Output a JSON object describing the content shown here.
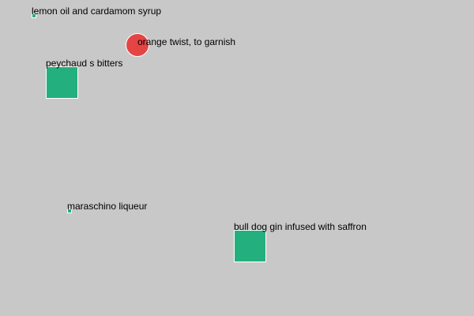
{
  "scene": {
    "background_color": "#c8c8c8",
    "objects": [
      {
        "label": "lemon oil and cardamom syrup",
        "shape": "square",
        "color": "#23b07e"
      },
      {
        "label": "orange twist, to garnish",
        "shape": "circle",
        "color": "#e54444"
      },
      {
        "label": "peychaud s bitters",
        "shape": "square",
        "color": "#23b07e"
      },
      {
        "label": "maraschino liqueur",
        "shape": "square",
        "color": "#23b07e"
      },
      {
        "label": "bull dog gin infused with saffron",
        "shape": "square",
        "color": "#23b07e"
      }
    ]
  }
}
